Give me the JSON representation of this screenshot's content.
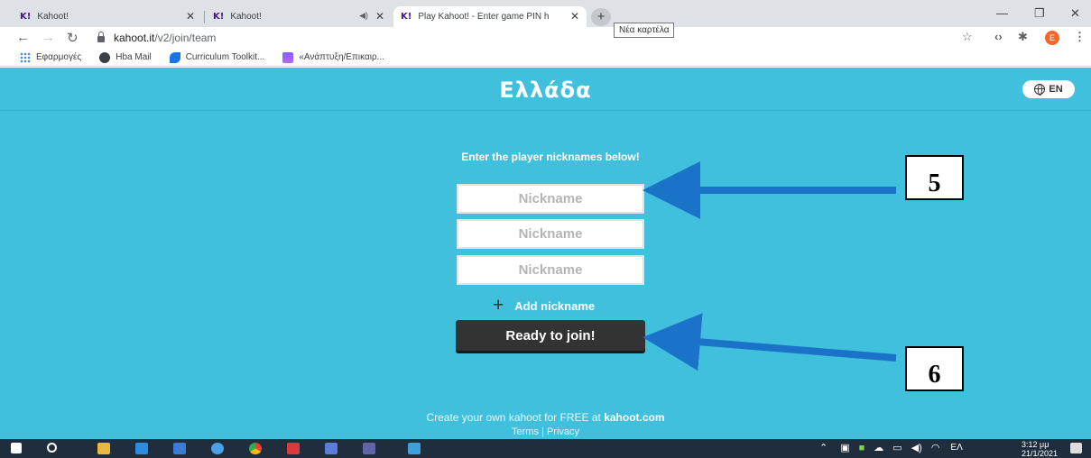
{
  "browser": {
    "tabs": [
      {
        "label": "Kahoot!",
        "favicon": "K!"
      },
      {
        "label": "Kahoot!",
        "favicon": "K!"
      },
      {
        "label": "Play Kahoot! - Enter game PIN h",
        "favicon": "K!"
      }
    ],
    "new_tab_tooltip": "Νέα καρτέλα",
    "url_host": "kahoot.it",
    "url_path": "/v2/join/team",
    "profile_initial": "E",
    "bookmarks": [
      {
        "label": "Εφαρμογές",
        "icon": "apps-icon"
      },
      {
        "label": "Hba Mail",
        "icon": "mail-icon"
      },
      {
        "label": "Curriculum Toolkit...",
        "icon": "curriculum-icon"
      },
      {
        "label": "«Ανάπτυξη/Επικαιρ...",
        "icon": "doc-icon"
      }
    ]
  },
  "page": {
    "title": "Ελλάδα",
    "language_label": "EN",
    "instructions": "Enter the player nicknames below!",
    "nickname_placeholder": "Nickname",
    "add_nickname_label": "Add nickname",
    "ready_button_label": "Ready to join!",
    "footer_text": "Create your own kahoot for FREE at ",
    "footer_link": "kahoot.com",
    "footer_terms": "Terms",
    "footer_privacy": "Privacy",
    "footer_separator": "|",
    "colors": {
      "background": "#40c0dc",
      "button": "#333333"
    }
  },
  "annotations": {
    "callout_5": "5",
    "callout_6": "6",
    "arrow_color": "#1a73c8"
  },
  "taskbar": {
    "time": "3:12 μμ",
    "date": "21/1/2021",
    "input_language": "ΕΛ"
  }
}
